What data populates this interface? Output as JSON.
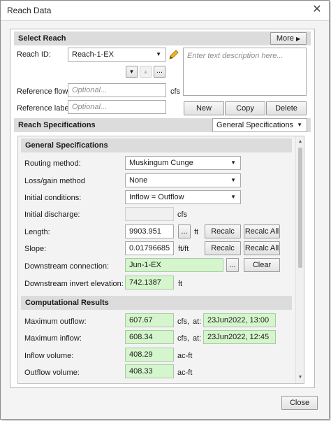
{
  "window": {
    "title": "Reach Data",
    "close_glyph": "✕"
  },
  "select_reach": {
    "header": "Select Reach",
    "more_label": "More",
    "reach_id_label": "Reach ID:",
    "reach_id_value": "Reach-1-EX",
    "description_placeholder": "Enter text description here...",
    "reference_flow_label": "Reference flow:",
    "reference_flow_placeholder": "Optional...",
    "reference_flow_unit": "cfs",
    "reference_label_label": "Reference label:",
    "reference_label_placeholder": "Optional...",
    "nav_more_label": "...",
    "buttons": {
      "new": "New",
      "copy": "Copy",
      "delete": "Delete"
    }
  },
  "reach_specs": {
    "header": "Reach Specifications",
    "view_select": "General Specifications"
  },
  "general": {
    "header": "General Specifications",
    "routing_method_label": "Routing method:",
    "routing_method_value": "Muskingum Cunge",
    "loss_gain_label": "Loss/gain method",
    "loss_gain_value": "None",
    "initial_conditions_label": "Initial conditions:",
    "initial_conditions_value": "Inflow = Outflow",
    "initial_discharge_label": "Initial discharge:",
    "initial_discharge_value": "",
    "initial_discharge_unit": "cfs",
    "length_label": "Length:",
    "length_value": "9903.951",
    "length_unit": "ft",
    "slope_label": "Slope:",
    "slope_value": "0.01796685",
    "slope_unit": "ft/ft",
    "recalc_label": "Recalc",
    "recalc_all_label": "Recalc All",
    "ellipsis_label": "...",
    "downstream_connection_label": "Downstream connection:",
    "downstream_connection_value": "Jun-1-EX",
    "clear_label": "Clear",
    "downstream_invert_label": "Downstream invert elevation:",
    "downstream_invert_value": "742.1387",
    "downstream_invert_unit": "ft"
  },
  "results": {
    "header": "Computational Results",
    "max_outflow_label": "Maximum outflow:",
    "max_outflow_value": "607.67",
    "max_outflow_unit": "cfs,",
    "max_outflow_at": "at:",
    "max_outflow_time": "23Jun2022, 13:00",
    "max_inflow_label": "Maximum inflow:",
    "max_inflow_value": "608.34",
    "max_inflow_unit": "cfs,",
    "max_inflow_at": "at:",
    "max_inflow_time": "23Jun2022, 12:45",
    "inflow_volume_label": "Inflow volume:",
    "inflow_volume_value": "408.29",
    "inflow_volume_unit": "ac-ft",
    "outflow_volume_label": "Outflow volume:",
    "outflow_volume_value": "408.33",
    "outflow_volume_unit": "ac-ft"
  },
  "footer": {
    "close_label": "Close"
  },
  "colors": {
    "result_field": "#d5f5cc",
    "section_header": "#dcdcdc",
    "pencil": "#e0a100"
  }
}
